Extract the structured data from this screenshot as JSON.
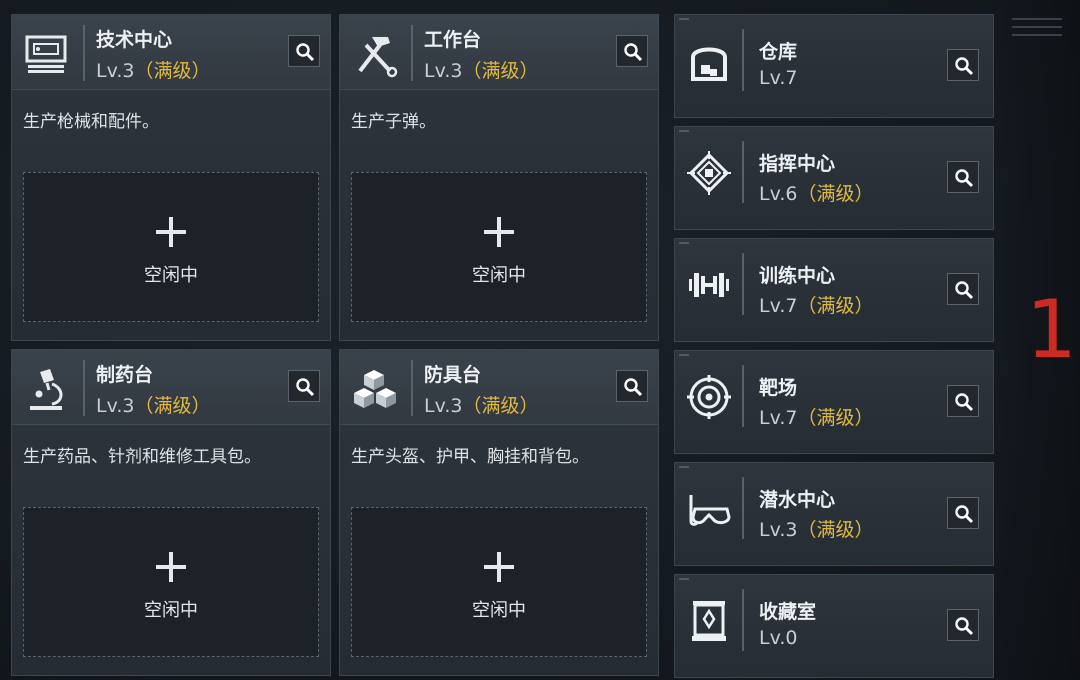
{
  "idle_label": "空闲中",
  "big_facilities": [
    {
      "name": "技术中心",
      "level": "Lv.3",
      "maxed": "（满级）",
      "description": "生产枪械和配件。",
      "icon": "computer-icon"
    },
    {
      "name": "工作台",
      "level": "Lv.3",
      "maxed": "（满级）",
      "description": "生产子弹。",
      "icon": "hammer-wrench-icon"
    },
    {
      "name": "制药台",
      "level": "Lv.3",
      "maxed": "（满级）",
      "description": "生产药品、针剂和维修工具包。",
      "icon": "microscope-icon"
    },
    {
      "name": "防具台",
      "level": "Lv.3",
      "maxed": "（满级）",
      "description": "生产头盔、护甲、胸挂和背包。",
      "icon": "cubes-icon"
    }
  ],
  "small_facilities": [
    {
      "name": "仓库",
      "level": "Lv.7",
      "maxed": "",
      "icon": "warehouse-icon"
    },
    {
      "name": "指挥中心",
      "level": "Lv.6",
      "maxed": "（满级）",
      "icon": "chip-icon"
    },
    {
      "name": "训练中心",
      "level": "Lv.7",
      "maxed": "（满级）",
      "icon": "dumbbell-icon"
    },
    {
      "name": "靶场",
      "level": "Lv.7",
      "maxed": "（满级）",
      "icon": "target-icon"
    },
    {
      "name": "潜水中心",
      "level": "Lv.3",
      "maxed": "（满级）",
      "icon": "diving-mask-icon"
    },
    {
      "name": "收藏室",
      "level": "Lv.0",
      "maxed": "",
      "icon": "display-case-icon"
    }
  ],
  "side_marker": "1",
  "colors": {
    "maxed": "#e2b83f",
    "marker": "#cc2a22"
  }
}
